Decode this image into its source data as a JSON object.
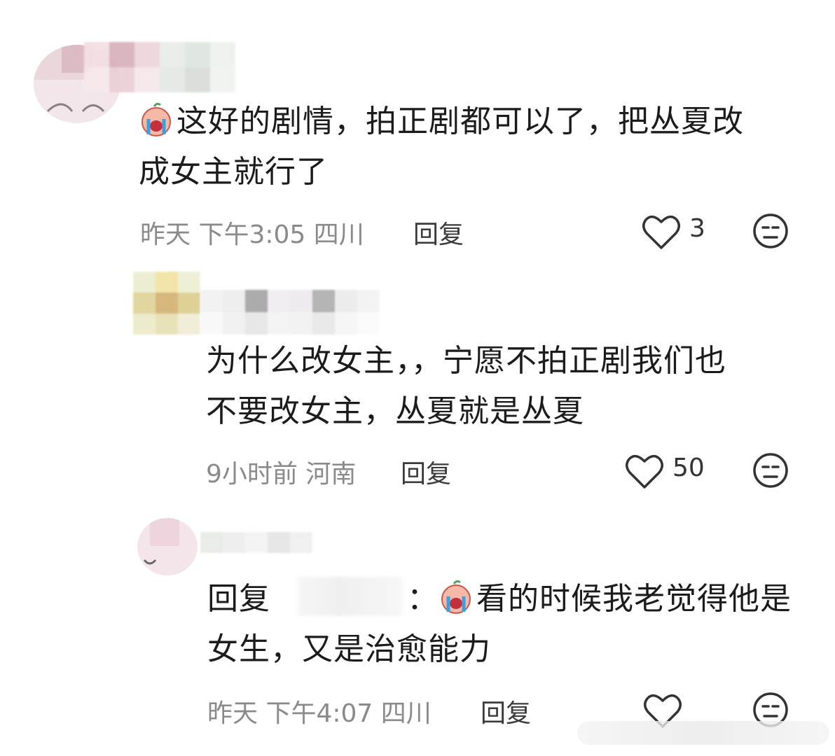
{
  "comments": [
    {
      "content": "这好的剧情，拍正剧都可以了，把丛夏改成女主就行了",
      "line1": "这好的剧情，拍正剧都可以了，把丛夏改",
      "line2": "成女主就行了",
      "time": "昨天 下午3:05",
      "location": "四川",
      "reply_label": "回复",
      "likes": "3",
      "emoji": "crying-face"
    },
    {
      "line1": "为什么改女主，，宁愿不拍正剧我们也",
      "line2": "不要改女主，丛夏就是丛夏",
      "time": "9小时前",
      "location": "河南",
      "reply_label": "回复",
      "likes": "50"
    },
    {
      "reply_prefix": "回复",
      "colon": "：",
      "line1": "看的时候我老觉得他是",
      "line2": "女生，又是治愈能力",
      "time": "昨天 下午4:07",
      "location": "四川",
      "reply_label": "回复",
      "likes": "",
      "emoji": "crying-face"
    }
  ],
  "icons": {
    "like": "heart-outline-icon",
    "dislike": "meh-face-icon"
  },
  "colors": {
    "text": "#1b1b1b",
    "meta": "#8a8a8a",
    "icon": "#333333"
  }
}
